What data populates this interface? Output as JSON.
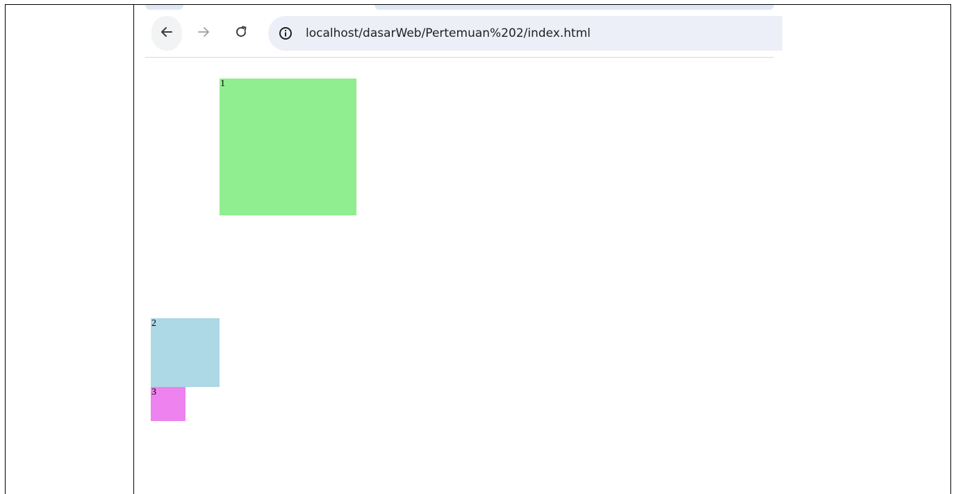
{
  "browser": {
    "url": "localhost/dasarWeb/Pertemuan%202/index.html",
    "icons": {
      "back": "arrow-left-icon",
      "forward": "arrow-right-icon",
      "reload": "reload-icon",
      "site_info": "info-icon"
    }
  },
  "page": {
    "boxes": [
      {
        "label": "1",
        "color": "#90ee90"
      },
      {
        "label": "2",
        "color": "#add8e6"
      },
      {
        "label": "3",
        "color": "#ee82ee"
      }
    ]
  }
}
